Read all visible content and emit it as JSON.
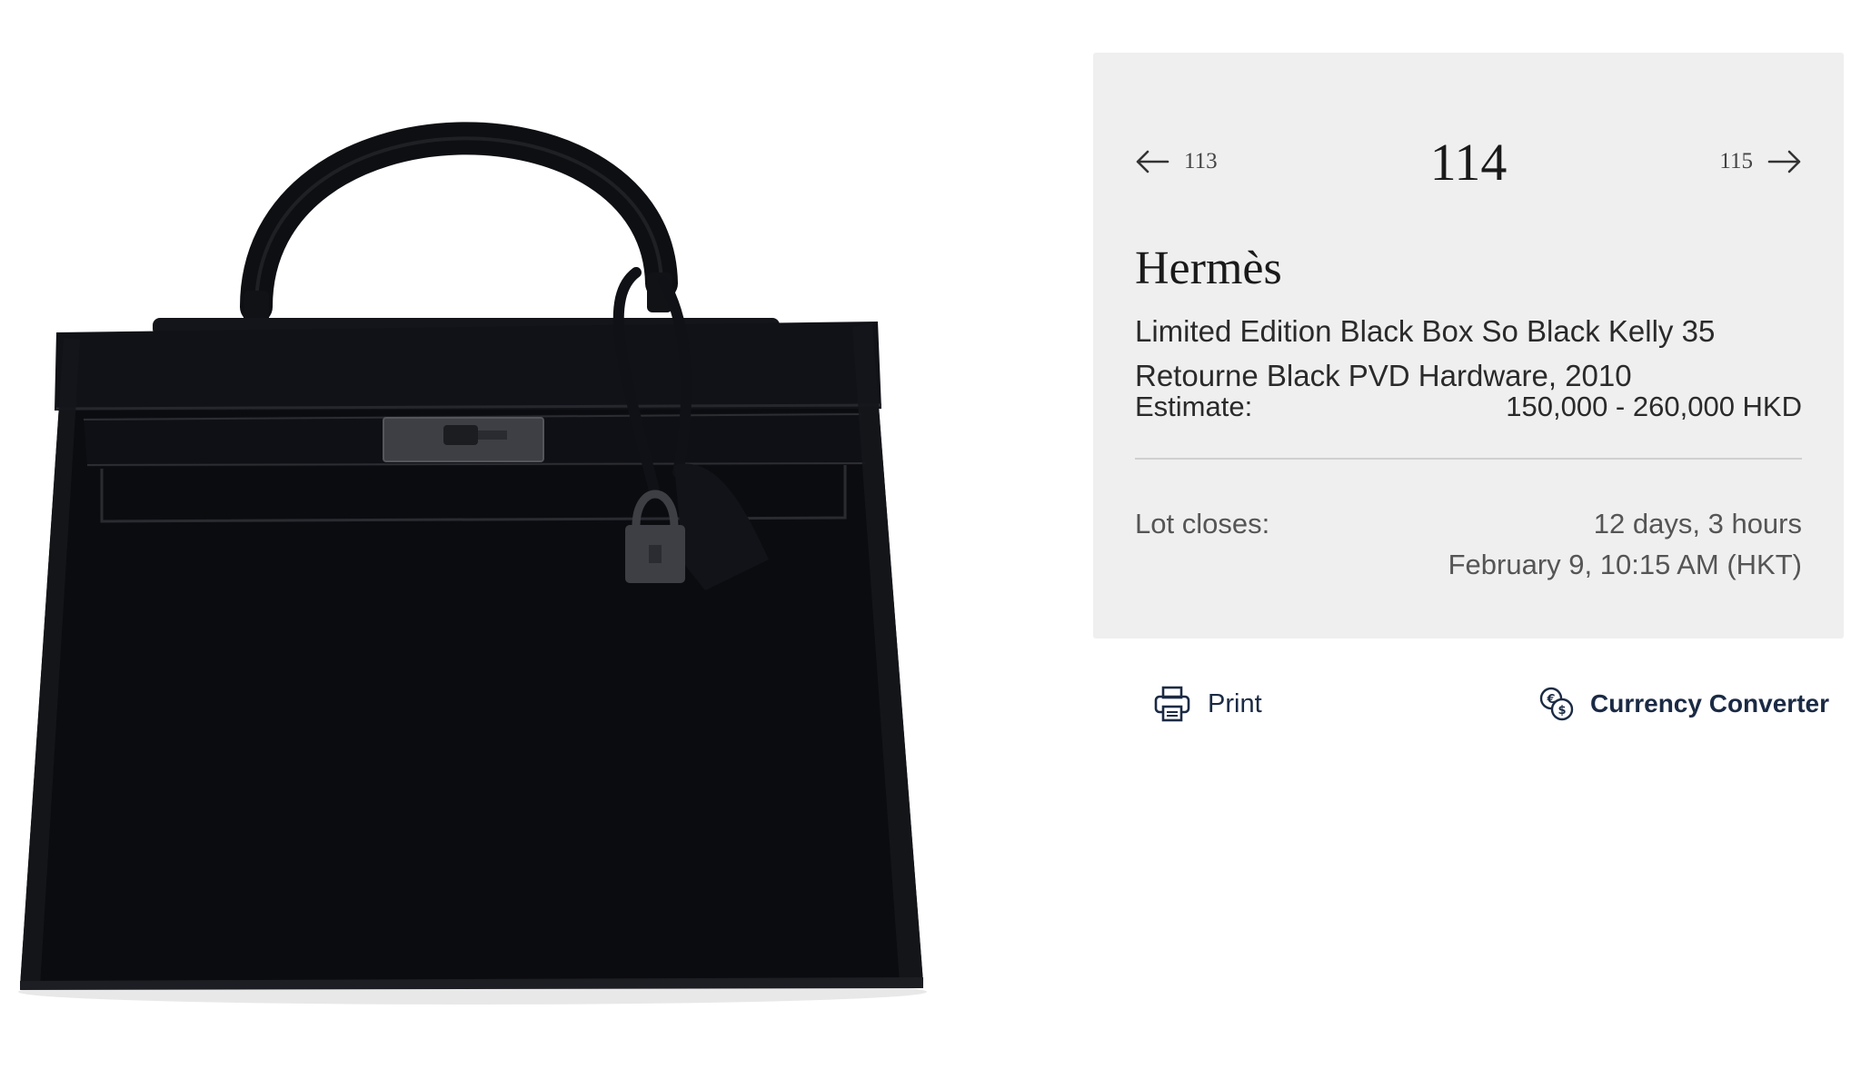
{
  "product_image": {
    "alt": "Black leather Kelly handbag with black hardware"
  },
  "lot_nav": {
    "prev_lot": "113",
    "current_lot": "114",
    "next_lot": "115",
    "prev_icon": "arrow-left-icon",
    "next_icon": "arrow-right-icon"
  },
  "lot": {
    "maker": "Hermès",
    "title": "Limited Edition Black Box So Black Kelly 35 Retourne Black PVD Hardware, 2010",
    "estimate_label": "Estimate:",
    "estimate_value": "150,000 - 260,000 HKD",
    "closes_label": "Lot closes:",
    "closes_countdown": "12 days, 3 hours",
    "closes_datetime": "February 9, 10:15 AM (HKT)"
  },
  "actions": {
    "print_label": "Print",
    "print_icon": "printer-icon",
    "currency_label": "Currency Converter",
    "currency_icon": "currency-exchange-icon"
  },
  "colors": {
    "panel_background": "#efefef",
    "action_text": "#1b2a44",
    "bag": "#0b0c10",
    "hardware": "#3e3f44"
  }
}
